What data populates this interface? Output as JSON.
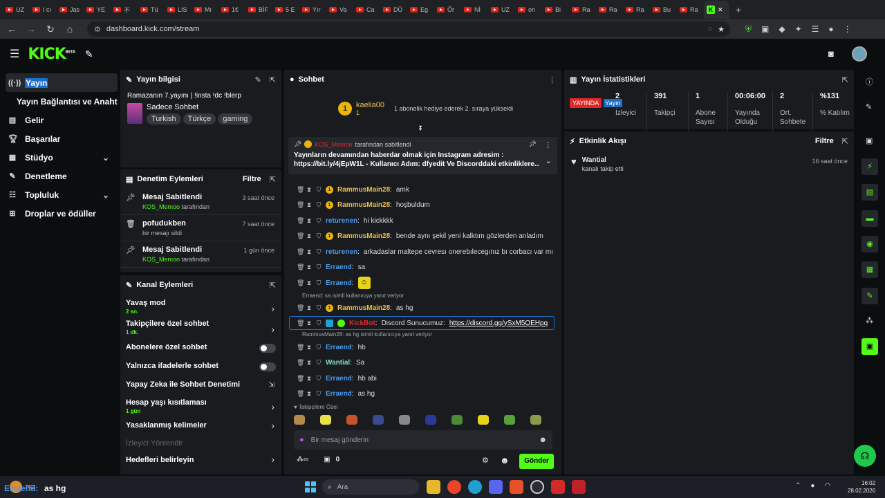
{
  "browser": {
    "tabs": [
      "UZ",
      "I cı",
      "Jas",
      "YE",
      "不",
      "Tü",
      "LIS",
      "Mı",
      "1€",
      "BİF",
      "5 E",
      "Yır",
      "Va",
      "Ca",
      "DÜ",
      "Eg",
      "Ör",
      "Nİ",
      "UZ",
      "on",
      "Bi",
      "Ra",
      "Ra",
      "Ra",
      "Bu",
      "Ra"
    ],
    "url": "dashboard.kick.com/stream"
  },
  "sidebar": {
    "items": [
      {
        "label": "Yayın",
        "icon": "broadcast-icon"
      },
      {
        "label": "Yayın Bağlantısı ve Anahtar",
        "icon": ""
      },
      {
        "label": "Gelir",
        "icon": "money-icon"
      },
      {
        "label": "Başarılar",
        "icon": "trophy-icon"
      },
      {
        "label": "Stüdyo",
        "icon": "studio-icon"
      },
      {
        "label": "Denetleme",
        "icon": "wrench-icon"
      },
      {
        "label": "Topluluk",
        "icon": "community-icon"
      },
      {
        "label": "Droplar ve ödüller",
        "icon": "drops-icon"
      }
    ]
  },
  "stream_info": {
    "header": "Yayın bilgisi",
    "title": "Ramazanın 7.yayını | !insta !dc !blerp",
    "category": "Sadece Sohbet",
    "tags": [
      "Turkish",
      "Türkçe",
      "gaming"
    ]
  },
  "mod_actions": {
    "header": "Denetim Eylemleri",
    "filter": "Filtre",
    "rows": [
      {
        "title": "Mesaj Sabitlendi",
        "user": "KOS_Memoo",
        "suffix": "tarafından",
        "time": "3 saat önce"
      },
      {
        "title": "pofudukben",
        "sub": "bir mesajı sildi",
        "time": "7 saat önce"
      },
      {
        "title": "Mesaj Sabitlendi",
        "user": "KOS_Memoo",
        "suffix": "tarafından",
        "time": "1 gün önce"
      }
    ]
  },
  "channel_actions": {
    "header": "Kanal Eylemleri",
    "items": [
      {
        "label": "Yavaş mod",
        "sub": "2 sn.",
        "control": "arrow"
      },
      {
        "label": "Takipçilere özel sohbet",
        "sub": "1 dk.",
        "control": "arrow"
      },
      {
        "label": "Abonelere özel sohbet",
        "sub": "",
        "control": "toggle"
      },
      {
        "label": "Yalnızca ifadelerle sohbet",
        "sub": "",
        "control": "toggle"
      },
      {
        "label": "Yapay Zeka ile Sohbet Denetimi",
        "sub": "",
        "control": "external"
      },
      {
        "label": "Hesap yaşı kısıtlaması",
        "sub": "1 gün",
        "control": "arrow"
      },
      {
        "label": "Yasaklanmış kelimeler",
        "sub": "",
        "control": "arrow"
      },
      {
        "label": "İzleyici Yönlendir",
        "sub": "",
        "control": "none",
        "muted": true
      },
      {
        "label": "Hedefleri belirleyin",
        "sub": "",
        "control": "arrow"
      }
    ]
  },
  "chat": {
    "header": "Sohbet",
    "gift": {
      "user": "kaelia00",
      "count": "1",
      "text": "1 abonelik hediye ederek 2. sıraya yükseldi"
    },
    "pinned": {
      "user": "KOS_Memoo",
      "by": "tarafından sabitlendi",
      "line1": "Yayınların devamından haberdar olmak için Instagram adresim :",
      "line2": "https://bit.ly/4jEpW1L - Kullanıcı Adım: dfyedit Ve Discorddaki etkinliklere..."
    },
    "messages": [
      {
        "user": "RammusMain28",
        "color": "gold",
        "badge": true,
        "text": "amk"
      },
      {
        "user": "RammusMain28",
        "color": "gold",
        "badge": true,
        "text": "hoşbuldum"
      },
      {
        "user": "returenen",
        "color": "blue",
        "badge": false,
        "text": "hi kickkkk"
      },
      {
        "user": "RammusMain28",
        "color": "gold",
        "badge": true,
        "text": "bende aynı şekil yeni kalktım gözlerden anladım"
      },
      {
        "user": "returenen",
        "color": "blue",
        "badge": false,
        "text": "arkadaslar maltepe cevresı onerebılecegınız bı corbacı var mı"
      },
      {
        "user": "Erraend",
        "color": "blue",
        "badge": false,
        "text": "sa"
      },
      {
        "user": "Erraend",
        "color": "blue",
        "badge": false,
        "text": "",
        "emote": true
      }
    ],
    "reply1": "Erraend: sa isimli kullanıcıya yanıt veriyor",
    "msg_after_reply1": {
      "user": "RammusMain28",
      "text": "as hg"
    },
    "bot_msg": {
      "user": "KickBot",
      "text": "Discord Sunucumuz:",
      "link": "https://discord.gg/ySxM5QEHpq"
    },
    "reply2": "RammusMain28: as hg isimli kullanıcıya yanıt veriyor",
    "messages2": [
      {
        "user": "Erraend",
        "color": "blue",
        "text": "hb"
      },
      {
        "user": "Wantial",
        "color": "mint",
        "text": "Sa"
      },
      {
        "user": "Erraend",
        "color": "blue",
        "text": "hb abi"
      },
      {
        "user": "Erraend",
        "color": "blue",
        "text": "as hg"
      }
    ],
    "followers_only": "Takipçilere Özel",
    "input_placeholder": "Bir mesaj gönderin",
    "points": "0",
    "send": "Gönder"
  },
  "stats": {
    "header": "Yayın İstatistikleri",
    "live": "YAYINDA",
    "live_sub": "Yayın",
    "items": [
      {
        "value": "2",
        "label": "İzleyici"
      },
      {
        "value": "391",
        "label": "Takipçi"
      },
      {
        "value": "1",
        "label": "Abone Sayısı"
      },
      {
        "value": "00:06:00",
        "label": "Yayında Olduğu"
      },
      {
        "value": "2",
        "label": "Ort. Sohbete"
      },
      {
        "value": "%131",
        "label": "% Katılım"
      }
    ]
  },
  "activity": {
    "header": "Etkinlik Akışı",
    "filter": "Filtre",
    "items": [
      {
        "user": "Wantial",
        "text": "kanalı takip etti",
        "time": "16 saat önce"
      }
    ]
  },
  "taskbar": {
    "weather": "7°C",
    "overlay_user": "Erraend:",
    "overlay_text": "as hg",
    "search": "Ara",
    "time": "16:02",
    "date": "28.02.2026"
  },
  "colors": {
    "accent": "#53fc18",
    "highlight": "#1b6fc9",
    "panel": "#191b1f"
  }
}
